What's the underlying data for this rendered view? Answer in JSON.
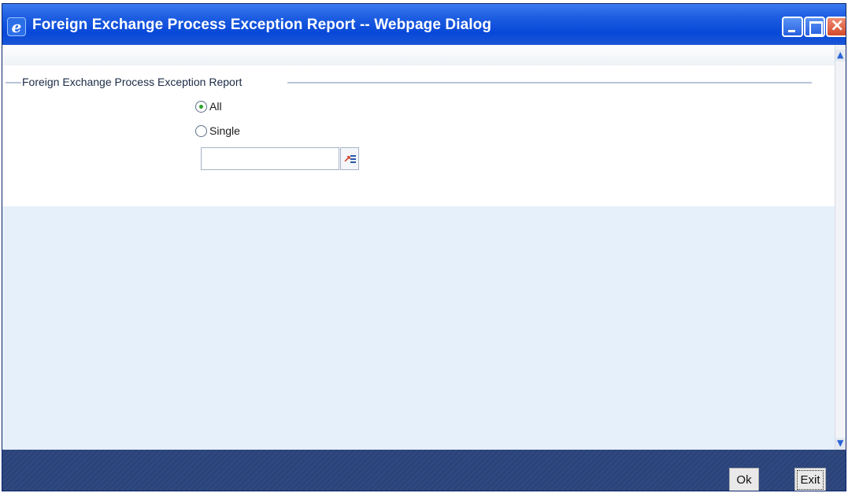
{
  "window": {
    "title": "Foreign Exchange Process Exception Report -- Webpage Dialog",
    "icon": "ie-icon",
    "controls": [
      "minimize-icon",
      "maximize-icon",
      "close-icon"
    ]
  },
  "form": {
    "section_title": "Foreign Exchange Process Exception Report",
    "options": [
      {
        "label": "All",
        "selected": true
      },
      {
        "label": "Single",
        "selected": false
      }
    ],
    "single_value": "",
    "lov_icon": "list-of-values-icon"
  },
  "footer": {
    "ok_label": "Ok",
    "exit_label": "Exit"
  },
  "colors": {
    "titlebar": "#0848d8",
    "lower_pane": "#e6f0fb",
    "footer": "#2f4980"
  }
}
